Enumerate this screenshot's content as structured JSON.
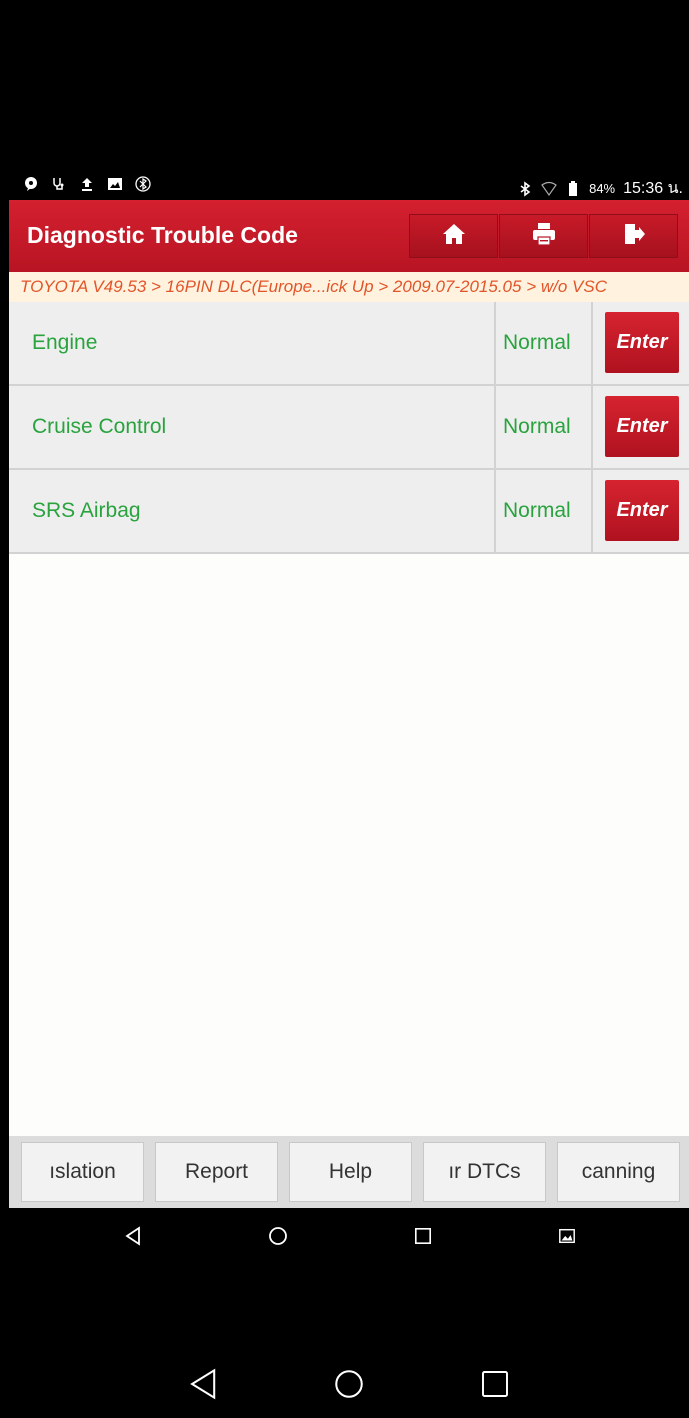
{
  "status_bar": {
    "battery": "84%",
    "time": "15:36 น.",
    "left_icons": [
      "chat-icon",
      "stethoscope-icon",
      "upload-icon",
      "image-icon",
      "bluetooth-circle-icon"
    ],
    "right_icons": [
      "bluetooth-icon",
      "wifi-icon",
      "battery-icon"
    ]
  },
  "header": {
    "title": "Diagnostic Trouble Code",
    "buttons": [
      "home-icon",
      "print-icon",
      "exit-icon"
    ]
  },
  "breadcrumb": "TOYOTA V49.53 > 16PIN DLC(Europe...ick Up > 2009.07-2015.05 > w/o VSC",
  "systems": [
    {
      "name": "Engine",
      "status": "Normal",
      "action": "Enter"
    },
    {
      "name": "Cruise Control",
      "status": "Normal",
      "action": "Enter"
    },
    {
      "name": "SRS Airbag",
      "status": "Normal",
      "action": "Enter"
    }
  ],
  "toolbar": {
    "translation": "ıslation",
    "report": "Report",
    "help": "Help",
    "clear_dtcs": "ır DTCs",
    "scanning": "canning"
  },
  "nav": {
    "inner": [
      "back-icon",
      "home-circle-icon",
      "recents-icon",
      "screenshot-icon"
    ],
    "outer": [
      "back-icon",
      "home-circle-icon",
      "recents-icon"
    ]
  },
  "colors": {
    "header_red": "#c81a28",
    "status_green": "#2aa33f",
    "breadcrumb_orange": "#e2552a"
  }
}
